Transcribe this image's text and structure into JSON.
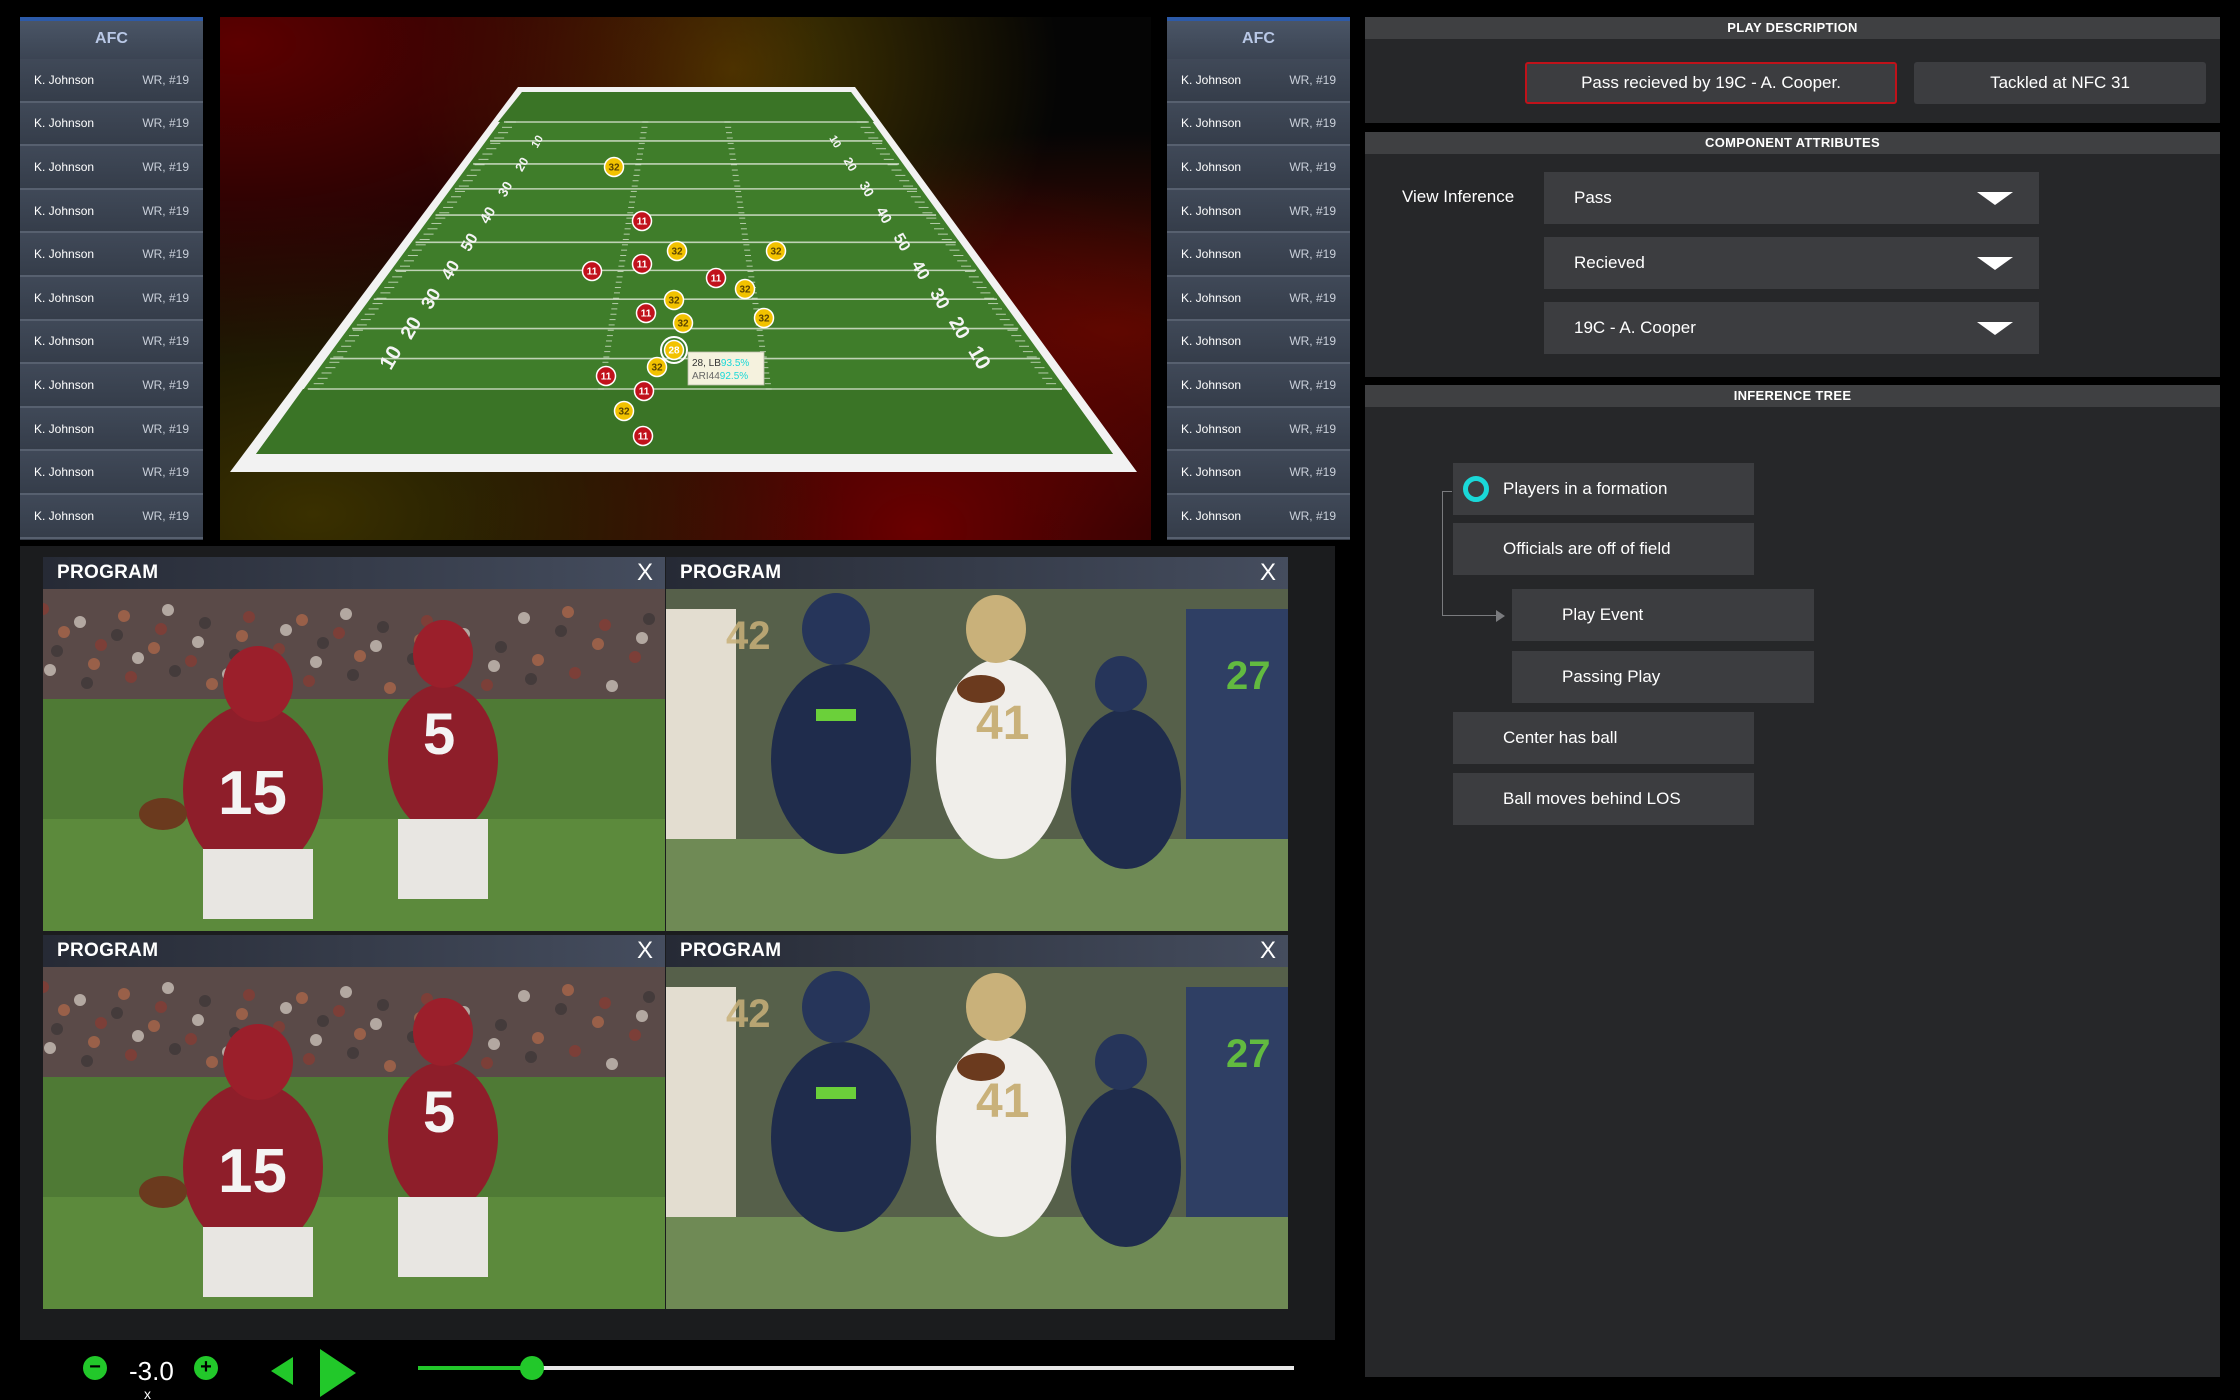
{
  "rosters": {
    "left": {
      "conference": "AFC",
      "players": [
        {
          "name": "K. Johnson",
          "pos": "WR, #19"
        },
        {
          "name": "K. Johnson",
          "pos": "WR, #19"
        },
        {
          "name": "K. Johnson",
          "pos": "WR, #19"
        },
        {
          "name": "K. Johnson",
          "pos": "WR, #19"
        },
        {
          "name": "K. Johnson",
          "pos": "WR, #19"
        },
        {
          "name": "K. Johnson",
          "pos": "WR, #19"
        },
        {
          "name": "K. Johnson",
          "pos": "WR, #19"
        },
        {
          "name": "K. Johnson",
          "pos": "WR, #19"
        },
        {
          "name": "K. Johnson",
          "pos": "WR, #19"
        },
        {
          "name": "K. Johnson",
          "pos": "WR, #19"
        },
        {
          "name": "K. Johnson",
          "pos": "WR, #19"
        }
      ]
    },
    "right": {
      "conference": "AFC",
      "players": [
        {
          "name": "K. Johnson",
          "pos": "WR, #19"
        },
        {
          "name": "K. Johnson",
          "pos": "WR, #19"
        },
        {
          "name": "K. Johnson",
          "pos": "WR, #19"
        },
        {
          "name": "K. Johnson",
          "pos": "WR, #19"
        },
        {
          "name": "K. Johnson",
          "pos": "WR, #19"
        },
        {
          "name": "K. Johnson",
          "pos": "WR, #19"
        },
        {
          "name": "K. Johnson",
          "pos": "WR, #19"
        },
        {
          "name": "K. Johnson",
          "pos": "WR, #19"
        },
        {
          "name": "K. Johnson",
          "pos": "WR, #19"
        },
        {
          "name": "K. Johnson",
          "pos": "WR, #19"
        },
        {
          "name": "K. Johnson",
          "pos": "WR, #19"
        }
      ]
    }
  },
  "field": {
    "yard_numbers_left": [
      "10",
      "20",
      "30",
      "40",
      "50",
      "40",
      "30",
      "20",
      "10"
    ],
    "team_red_jersey": "11",
    "team_yellow_jersey": "32",
    "highlighted_player": "28",
    "tooltip": {
      "line1_label": "28, LB",
      "line1_value": "93.5%",
      "line2_label": "ARI44",
      "line2_value": "92.5%"
    },
    "colors": {
      "turf": "#3f7d2a",
      "red_team": "#c1121c",
      "yellow_team": "#f2c200",
      "tooltip_value": "#1ad8d8"
    }
  },
  "play_description": {
    "title": "PLAY DESCRIPTION",
    "events": [
      {
        "label": "Pass recieved by 19C - A. Cooper.",
        "selected": true
      },
      {
        "label": "Tackled at NFC 31",
        "selected": false
      }
    ]
  },
  "component_attributes": {
    "title": "COMPONENT ATTRIBUTES",
    "view_label": "View Inference",
    "dropdowns": [
      {
        "value": "Pass"
      },
      {
        "value": "Recieved"
      },
      {
        "value": "19C - A. Cooper"
      }
    ]
  },
  "inference_tree": {
    "title": "INFERENCE TREE",
    "nodes": {
      "formation": "Players in a formation",
      "officials": "Officials are off of field",
      "play_event": "Play Event",
      "passing_play": "Passing Play",
      "center": "Center has ball",
      "ball_moves": "Ball moves behind LOS"
    },
    "active_node_color": "#1ad8d8"
  },
  "programs": [
    {
      "title": "PROGRAM",
      "close": "X",
      "scene": "red-team"
    },
    {
      "title": "PROGRAM",
      "close": "X",
      "scene": "blue-white-team"
    },
    {
      "title": "PROGRAM",
      "close": "X",
      "scene": "red-team"
    },
    {
      "title": "PROGRAM",
      "close": "X",
      "scene": "blue-white-team"
    }
  ],
  "transport": {
    "speed": "-3.0",
    "speed_unit": "x",
    "minus": "−",
    "plus": "+",
    "progress": 0.13,
    "accent": "#22c82a"
  }
}
